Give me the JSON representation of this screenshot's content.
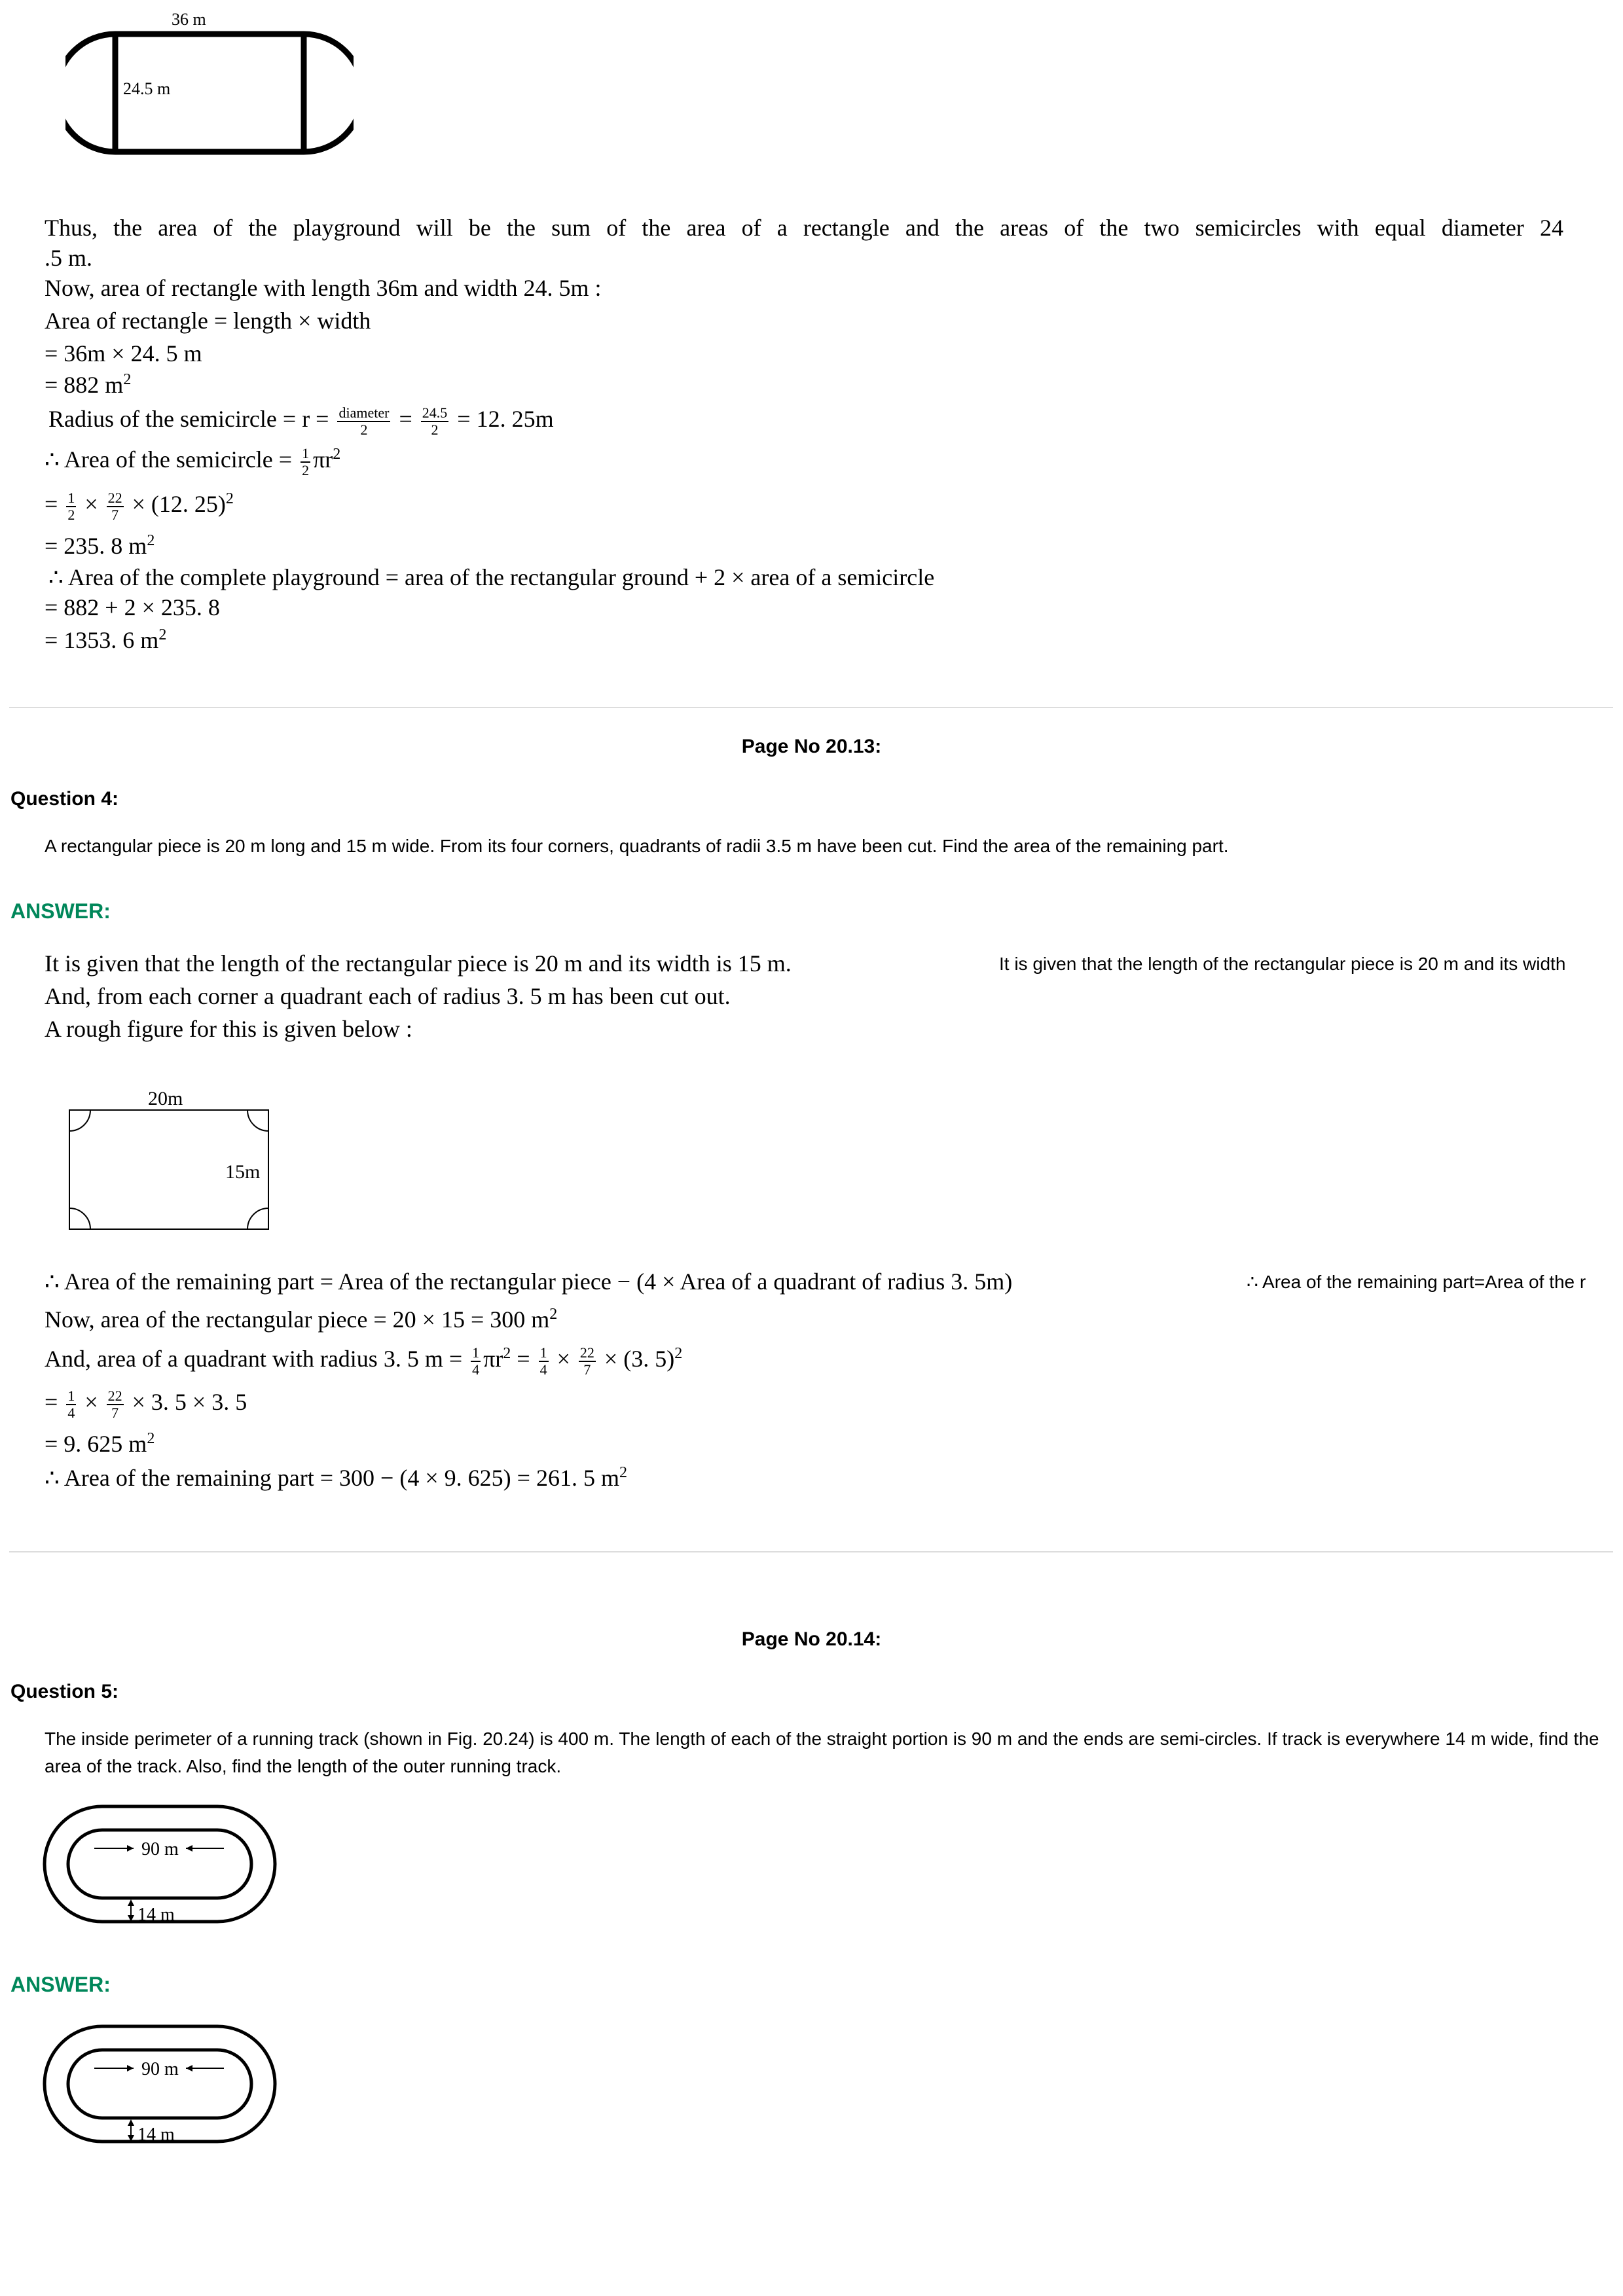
{
  "figure1": {
    "length_label": "36 m",
    "width_label": "24.5 m"
  },
  "solution3": {
    "intro": "Thus, the area of the playground will be the sum of the area of a rectangle and the areas of the two semicircles with equal diameter 24",
    "intro_cont": ".5 m.",
    "line1": "Now, area of rectangle with length 36m and width 24. 5m :",
    "line2": "Area of rectangle = length × width",
    "line3": "= 36m × 24. 5 m",
    "line4": "= 882 m",
    "line5_a": "Radius of the semicircle = r =",
    "line5_frac1_num": "diameter",
    "line5_frac1_den": "2",
    "line5_eq": "=",
    "line5_frac2_num": "24.5",
    "line5_frac2_den": "2",
    "line5_b": "= 12. 25m",
    "line6_a": "∴ Area of the semicircle =",
    "line6_b": "πr",
    "line7_a": "=",
    "line7_b": "×",
    "line7_c": "× (12. 25)",
    "line8": "= 235. 8 m",
    "line9": "∴ Area of the complete playground = area of the rectangular ground + 2 × area of a semicircle",
    "line10": "= 882 + 2 × 235. 8",
    "line11": "= 1353. 6 m"
  },
  "page_20_13": "Page No 20.13:",
  "question4": {
    "heading": "Question 4:",
    "text": "A rectangular piece is 20 m long and 15 m wide. From its four corners, quadrants of radii 3.5 m have been cut. Find the area of the remaining part."
  },
  "answer_label": "ANSWER:",
  "solution4": {
    "line1": "It is given that the length of the rectangular piece is 20 m and its width is 15 m.",
    "side1": "It is given that the length of the rectangular piece is 20 m and its width",
    "line2": "And, from each corner a quadrant each of radius 3. 5 m has been cut out.",
    "line3": "A rough figure for this is given below :",
    "fig_length": "20m",
    "fig_width": "15m",
    "line4": "∴ Area of the remaining part = Area of the rectangular piece − (4 × Area of a quadrant of radius 3. 5m)",
    "side2": "∴ Area of the remaining part=Area of the r",
    "line5": "Now, area of the rectangular piece = 20 × 15 = 300 m",
    "line6_a": "And, area of a quadrant with radius 3. 5 m =",
    "line6_b": "πr",
    "line6_c": "=",
    "line6_d": "×",
    "line6_e": "× (3. 5)",
    "line7_a": "=",
    "line7_b": "×",
    "line7_c": "× 3. 5 × 3. 5",
    "line8": "= 9. 625 m",
    "line9": "∴ Area of the remaining part = 300 − (4 × 9. 625) = 261. 5 m",
    "frac_1": "1",
    "frac_2": "2",
    "frac_4": "4",
    "frac_22": "22",
    "frac_7": "7",
    "sq": "2"
  },
  "page_20_14": "Page No 20.14:",
  "question5": {
    "heading": "Question 5:",
    "text": "The inside perimeter of a running track (shown in Fig. 20.24) is 400 m. The length of each of the straight portion is 90 m and the ends are semi-circles. If track is everywhere 14 m wide, find the area of the track. Also, find the length of the outer running track.",
    "fig_straight": "90 m",
    "fig_width": "14 m"
  }
}
